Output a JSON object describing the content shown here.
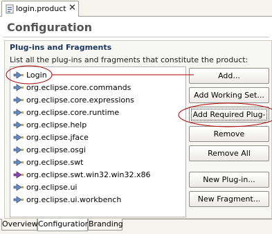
{
  "editor_tab": {
    "label": "login.product",
    "close_glyph": "✕",
    "icon": "product-file-icon"
  },
  "page": {
    "title": "Configuration"
  },
  "section": {
    "title": "Plug-ins and Fragments",
    "description": "List all the plug-ins and fragments that constitute the product:"
  },
  "plugins": [
    {
      "label": "Login",
      "icon": "plugin-icon"
    },
    {
      "label": "org.eclipse.core.commands",
      "icon": "plugin-icon"
    },
    {
      "label": "org.eclipse.core.expressions",
      "icon": "plugin-icon"
    },
    {
      "label": "org.eclipse.core.runtime",
      "icon": "plugin-icon"
    },
    {
      "label": "org.eclipse.help",
      "icon": "plugin-icon"
    },
    {
      "label": "org.eclipse.jface",
      "icon": "plugin-icon"
    },
    {
      "label": "org.eclipse.osgi",
      "icon": "plugin-icon"
    },
    {
      "label": "org.eclipse.swt",
      "icon": "plugin-icon"
    },
    {
      "label": "org.eclipse.swt.win32.win32.x86",
      "icon": "fragment-icon"
    },
    {
      "label": "org.eclipse.ui",
      "icon": "plugin-icon"
    },
    {
      "label": "org.eclipse.ui.workbench",
      "icon": "plugin-icon"
    }
  ],
  "buttons": {
    "add": "Add...",
    "add_working_set": "Add Working Set...",
    "add_required": "Add Required Plug-ins",
    "remove": "Remove",
    "remove_all": "Remove All",
    "new_plugin": "New Plug-in...",
    "new_fragment": "New Fragment..."
  },
  "bottom_tabs": [
    {
      "label": "Overview",
      "active": false
    },
    {
      "label": "Configuration",
      "active": true
    },
    {
      "label": "Branding",
      "active": false
    }
  ],
  "colors": {
    "section_title": "#1c3760",
    "annotation": "#b00000",
    "plugin_icon": "#6a8ab8",
    "fragment_icon": "#8a4ca8"
  }
}
